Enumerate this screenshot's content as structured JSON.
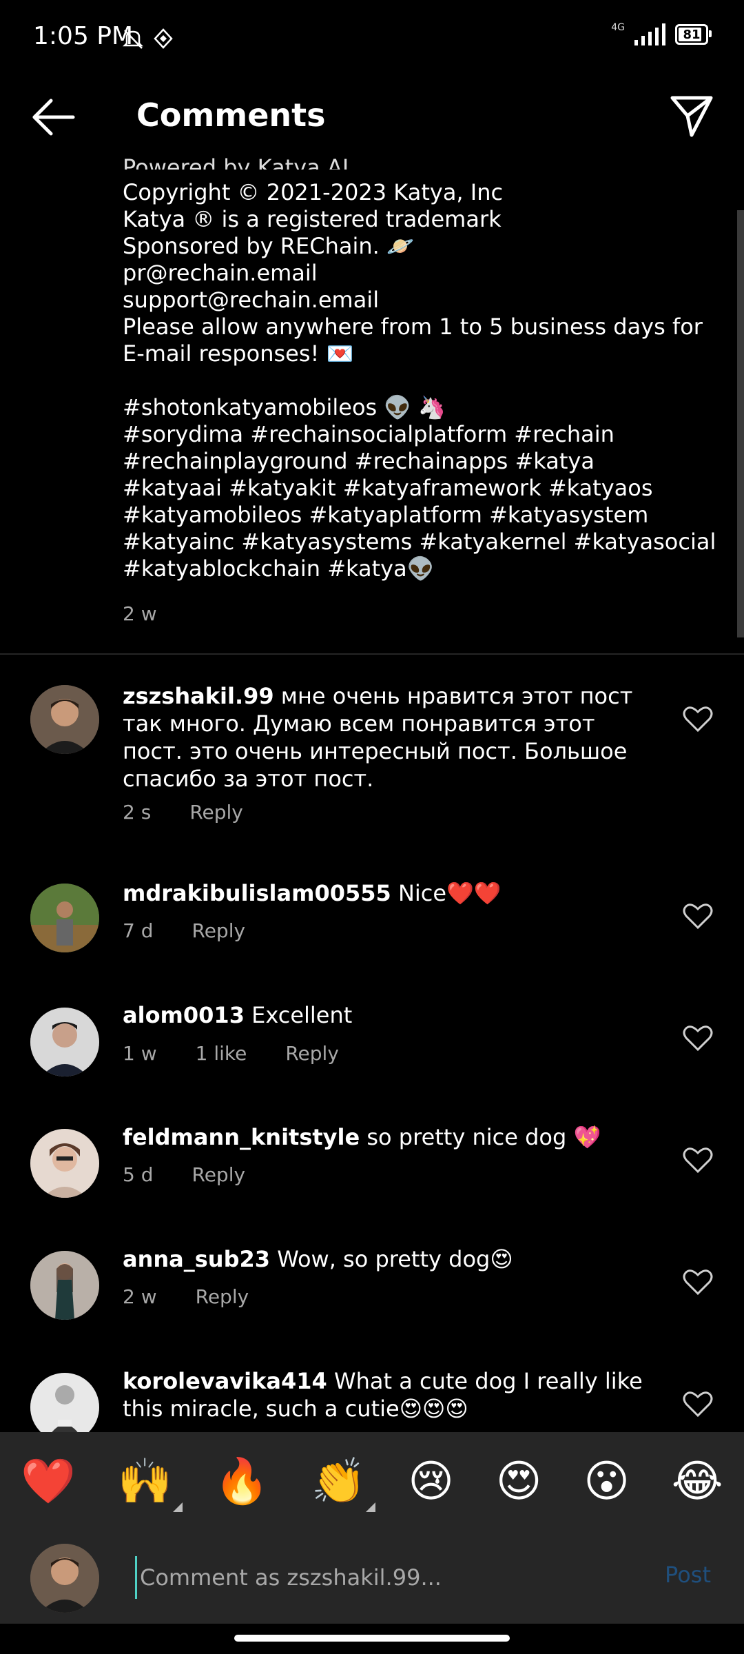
{
  "status": {
    "time": "1:05 PM",
    "network": "4G",
    "battery": "81"
  },
  "header": {
    "title": "Comments"
  },
  "caption": {
    "cut_text": "Powered by Katya AI",
    "lines": [
      "Copyright © 2021-2023 Katya, Inc",
      "Katya ® is a registered trademark",
      "Sponsored by REChain. 🪐",
      "pr@rechain.email",
      "support@rechain.email",
      "Please allow anywhere from 1 to 5 business days for",
      "E-mail responses! 💌",
      "",
      "#shotonkatyamobileos 👽 🦄",
      "#sorydima #rechainsocialplatform #rechain",
      "#rechainplayground #rechainapps #katya",
      "#katyaai #katyakit #katyaframework #katyaos",
      "#katyamobileos #katyaplatform #katyasystem",
      "#katyainc #katyasystems #katyakernel #katyasocial",
      "#katyablockchain #katya👽"
    ],
    "time": "2 w"
  },
  "comments": [
    {
      "username": "zszshakil.99",
      "text": "мне очень нравится этот пост так много. Думаю всем понравится этот пост. это очень интересный пост. Большое спасибо за этот пост.",
      "time": "2 s",
      "likes": "",
      "reply": "Reply"
    },
    {
      "username": "mdrakibulislam00555",
      "text": "Nice❤️❤️",
      "time": "7 d",
      "likes": "",
      "reply": "Reply"
    },
    {
      "username": "alom0013",
      "text": "Excellent",
      "time": "1 w",
      "likes": "1 like",
      "reply": "Reply"
    },
    {
      "username": "feldmann_knitstyle",
      "text": "so pretty nice dog 💖",
      "time": "5 d",
      "likes": "",
      "reply": "Reply"
    },
    {
      "username": "anna_sub23",
      "text": "Wow, so pretty dog😍",
      "time": "2 w",
      "likes": "",
      "reply": "Reply"
    },
    {
      "username": "korolevavika414",
      "text": "What a cute dog I really like this miracle, such a cutie😍😍😍",
      "time": "",
      "likes": "",
      "reply": ""
    }
  ],
  "emoji_bar": [
    "❤️",
    "🙌",
    "🔥",
    "👏",
    "😢",
    "😍",
    "😮",
    "😂"
  ],
  "input": {
    "placeholder": "Comment as zszshakil.99...",
    "post_label": "Post"
  },
  "colors": {
    "background": "#000000",
    "panel": "#262626",
    "secondary_text": "#a8a8a8",
    "post_button": "#1f4f7d",
    "cursor": "#4fd1c5"
  }
}
